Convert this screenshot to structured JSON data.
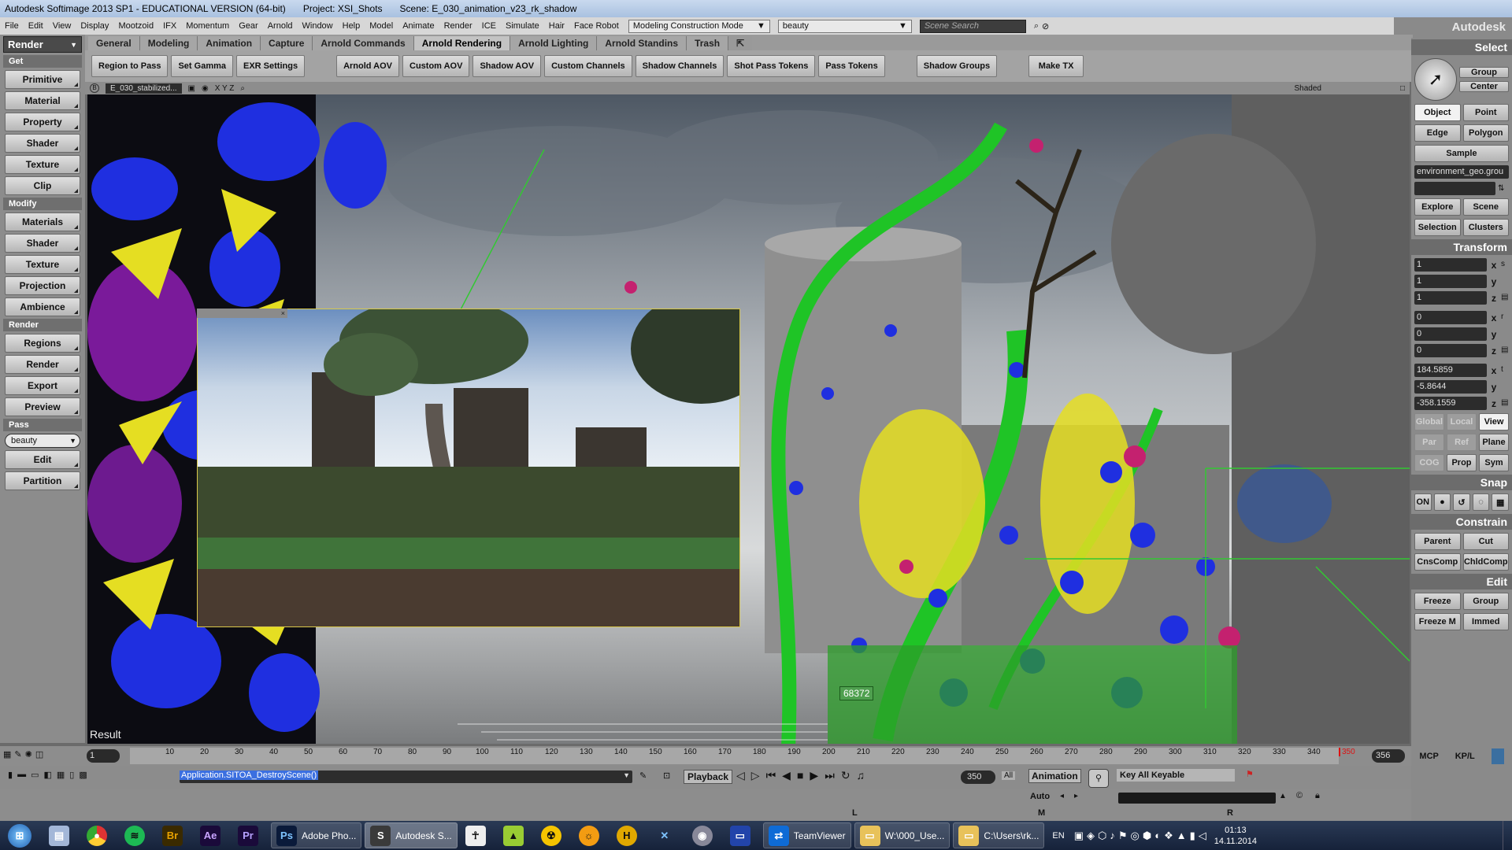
{
  "window": {
    "app_title": "Autodesk Softimage 2013 SP1 - EDUCATIONAL VERSION (64-bit)",
    "project": "Project: XSI_Shots",
    "scene": "Scene: E_030_animation_v23_rk_shadow",
    "brand": "Autodesk Softimage"
  },
  "menubar": {
    "items": [
      "File",
      "Edit",
      "View",
      "Display",
      "Mootzoid",
      "IFX",
      "Momentum",
      "Gear",
      "Arnold",
      "Window",
      "Help",
      "Model",
      "Animate",
      "Render",
      "ICE",
      "Simulate",
      "Hair",
      "Face Robot"
    ],
    "mode_select": "Modeling Construction Mode",
    "pass_select": "beauty",
    "search_placeholder": "Scene Search"
  },
  "left_panel": {
    "module": "Render",
    "sections": [
      {
        "title": "Get",
        "buttons": [
          "Primitive",
          "Material",
          "Property",
          "Shader",
          "Texture",
          "Clip"
        ]
      },
      {
        "title": "Modify",
        "buttons": [
          "Materials",
          "Shader",
          "Texture",
          "Projection",
          "Ambience"
        ]
      },
      {
        "title": "Render",
        "buttons": [
          "Regions",
          "Render",
          "Export",
          "Preview"
        ]
      },
      {
        "title": "Pass",
        "select": "beauty",
        "buttons": [
          "Edit",
          "Partition"
        ]
      }
    ]
  },
  "shelf": {
    "tabs": [
      "General",
      "Modeling",
      "Animation",
      "Capture",
      "Arnold Commands",
      "Arnold Rendering",
      "Arnold Lighting",
      "Arnold Standins",
      "Trash"
    ],
    "active_tab": "Arnold Rendering",
    "buttons": [
      "Region to Pass",
      "Set Gamma",
      "EXR Settings",
      "Arnold AOV",
      "Custom AOV",
      "Shadow AOV",
      "Custom Channels",
      "Shadow Channels",
      "Shot Pass Tokens",
      "Pass Tokens",
      "Shadow Groups",
      "Make TX"
    ]
  },
  "viewport": {
    "camera": "E_030_stabilized...",
    "axes": "X Y Z",
    "shading": "Shaded",
    "result_label": "Result",
    "counter": "68372"
  },
  "right_panel": {
    "select_title": "Select",
    "select_buttons": [
      "Group",
      "Center",
      "Object",
      "Point",
      "Edge",
      "Polygon",
      "Sample"
    ],
    "selection_text": "environment_geo.grou",
    "explore_buttons": [
      "Explore",
      "Scene",
      "Selection",
      "Clusters"
    ],
    "transform_title": "Transform",
    "scale": [
      "1",
      "1",
      "1"
    ],
    "rotate": [
      "0",
      "0",
      "0"
    ],
    "translate": [
      "184.5859",
      "-5.8644",
      "-358.1559"
    ],
    "ref_buttons": [
      "Global",
      "Local",
      "View",
      "Par",
      "Ref",
      "Plane",
      "COG",
      "Prop",
      "Sym"
    ],
    "snap_title": "Snap",
    "snap_on": "ON",
    "constrain_title": "Constrain",
    "constrain_buttons": [
      "Parent",
      "Cut",
      "CnsComp",
      "ChldComp"
    ],
    "edit_title": "Edit",
    "edit_buttons": [
      "Freeze",
      "Group",
      "Freeze M",
      "Immed"
    ]
  },
  "timeline": {
    "current": "1",
    "ticks": [
      "10",
      "20",
      "30",
      "40",
      "50",
      "60",
      "70",
      "80",
      "90",
      "100",
      "110",
      "120",
      "130",
      "140",
      "150",
      "160",
      "170",
      "180",
      "190",
      "200",
      "210",
      "220",
      "230",
      "240",
      "250",
      "260",
      "270",
      "280",
      "290",
      "300",
      "310",
      "320",
      "330",
      "340",
      "350"
    ],
    "end_marker": "350",
    "end_frame": "356",
    "right_buttons": [
      "MCP",
      "KP/L"
    ]
  },
  "command_bar": {
    "command": "Application.SITOA_DestroyScene()",
    "playback_label": "Playback",
    "frame_field": "350",
    "all_label": "All",
    "animation_label": "Animation",
    "auto_label": "Auto",
    "key_label": "Key All Keyable"
  },
  "status": {
    "L": "L",
    "M": "M",
    "R": "R"
  },
  "taskbar": {
    "tasks": [
      "Adobe Pho...",
      "Autodesk S...",
      "TeamViewer",
      "W:\\000_Use...",
      "C:\\Users\\rk..."
    ],
    "lang": "EN",
    "time": "01:13",
    "date": "14.11.2014"
  },
  "colors": {
    "accent_blue": "#1f3cff",
    "vine_green": "#22c32a",
    "leaf_yellow": "#e8e02a",
    "magenta": "#c4216f"
  }
}
